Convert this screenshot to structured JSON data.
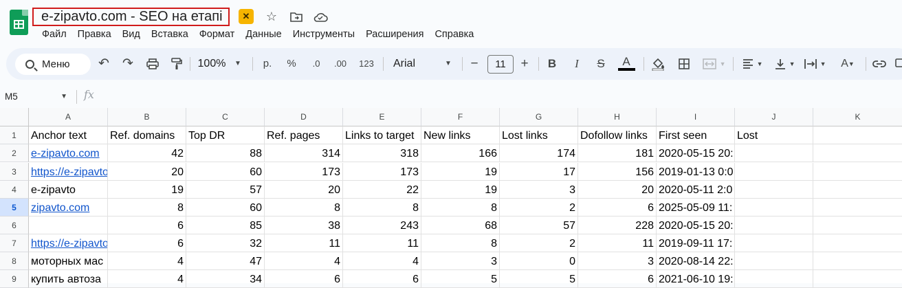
{
  "doc": {
    "title": "e-zipavto.com - SEO на етапі"
  },
  "title_icons": [
    "tag-icon",
    "star-icon",
    "move-folder-icon",
    "cloud-status-icon"
  ],
  "menu": [
    "Файл",
    "Правка",
    "Вид",
    "Вставка",
    "Формат",
    "Данные",
    "Инструменты",
    "Расширения",
    "Справка"
  ],
  "toolbar": {
    "search_label": "Меню",
    "zoom": "100%",
    "currency": "р.",
    "percent": "%",
    "decrease_decimal": ".0",
    "increase_decimal": ".00",
    "number_format": "123",
    "font": "Arial",
    "font_size": "11",
    "bold": "B",
    "italic": "I",
    "strike": "S",
    "text_color": "A"
  },
  "formula_bar": {
    "name_box": "M5",
    "fx": "fx"
  },
  "sheet": {
    "columns": [
      "A",
      "B",
      "C",
      "D",
      "E",
      "F",
      "G",
      "H",
      "I",
      "J",
      "K"
    ],
    "row_numbers": [
      "1",
      "2",
      "3",
      "4",
      "5",
      "6",
      "7",
      "8",
      "9"
    ],
    "active_row": "5",
    "header_row": [
      "Anchor text",
      "Ref. domains",
      "Top DR",
      "Ref. pages",
      "Links to target",
      "New links",
      "Lost links",
      "Dofollow links",
      "First seen",
      "Lost",
      ""
    ],
    "rows": [
      {
        "anchor": "e-zipavto.com",
        "link": true,
        "vals": [
          "42",
          "88",
          "314",
          "318",
          "166",
          "174",
          "181"
        ],
        "first_seen": "2020-05-15 20:",
        "lost": ""
      },
      {
        "anchor": "https://e-zipavto",
        "link": true,
        "vals": [
          "20",
          "60",
          "173",
          "173",
          "19",
          "17",
          "156"
        ],
        "first_seen": "2019-01-13 0:0",
        "lost": ""
      },
      {
        "anchor": "e-zipavto",
        "link": false,
        "vals": [
          "19",
          "57",
          "20",
          "22",
          "19",
          "3",
          "20"
        ],
        "first_seen": "2020-05-11 2:0",
        "lost": ""
      },
      {
        "anchor": "zipavto.com",
        "link": true,
        "vals": [
          "8",
          "60",
          "8",
          "8",
          "8",
          "2",
          "6"
        ],
        "first_seen": "2025-05-09 11:",
        "lost": ""
      },
      {
        "anchor": "",
        "link": false,
        "vals": [
          "6",
          "85",
          "38",
          "243",
          "68",
          "57",
          "228"
        ],
        "first_seen": "2020-05-15 20:",
        "lost": ""
      },
      {
        "anchor": "https://e-zipavto",
        "link": true,
        "vals": [
          "6",
          "32",
          "11",
          "11",
          "8",
          "2",
          "11"
        ],
        "first_seen": "2019-09-11 17:",
        "lost": ""
      },
      {
        "anchor": "моторных мас",
        "link": false,
        "vals": [
          "4",
          "47",
          "4",
          "4",
          "3",
          "0",
          "3"
        ],
        "first_seen": "2020-08-14 22:",
        "lost": ""
      },
      {
        "anchor": "купить автоза",
        "link": false,
        "vals": [
          "4",
          "34",
          "6",
          "6",
          "5",
          "5",
          "6"
        ],
        "first_seen": "2021-06-10 19:",
        "lost": ""
      }
    ]
  }
}
